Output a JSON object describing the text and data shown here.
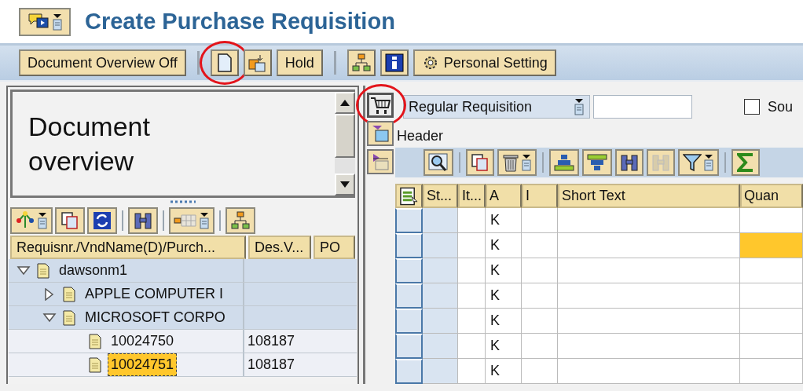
{
  "header": {
    "title": "Create Purchase Requisition"
  },
  "toolbar": [
    {
      "kind": "button",
      "label": "Document Overview Off",
      "highlighted": false
    },
    {
      "kind": "separator"
    },
    {
      "kind": "icon",
      "highlighted": true
    },
    {
      "kind": "icon",
      "highlighted": false
    },
    {
      "kind": "button",
      "label": "Hold",
      "highlighted": false
    },
    {
      "kind": "separator"
    },
    {
      "kind": "icon",
      "highlighted": false
    },
    {
      "kind": "icon",
      "highlighted": false
    },
    {
      "kind": "button",
      "label": "Personal Setting",
      "highlighted": false
    }
  ],
  "overview": {
    "title": "Document overview"
  },
  "tree": {
    "columns": [
      "Requisnr./VndName(D)/Purch...",
      "Des.V...",
      "PO"
    ],
    "items": [
      {
        "label": "dawsonm1",
        "expanded": true,
        "selected": false,
        "children": [
          {
            "label": "APPLE COMPUTER I",
            "expanded": false,
            "selected": false
          },
          {
            "label": "MICROSOFT CORPO",
            "expanded": true,
            "selected": false,
            "children": [
              {
                "label": "10024750",
                "des_v": "108187",
                "selected": false
              },
              {
                "label": "10024751",
                "des_v": "108187",
                "selected": true
              }
            ]
          }
        ]
      }
    ]
  },
  "document": {
    "cart_highlighted": true,
    "type": "Regular Requisition",
    "source_checkbox": {
      "label": "Sou",
      "checked": false
    },
    "section": "Header"
  },
  "grid": {
    "columns": [
      "St...",
      "It...",
      "A",
      "I",
      "Short Text",
      "Quan"
    ],
    "rows": [
      {
        "column_3": "K",
        "quantity_focused": false
      },
      {
        "column_3": "K",
        "quantity_focused": true
      },
      {
        "column_3": "K",
        "quantity_focused": false
      },
      {
        "column_3": "K",
        "quantity_focused": false
      },
      {
        "column_3": "K",
        "quantity_focused": false
      },
      {
        "column_3": "K",
        "quantity_focused": false
      },
      {
        "column_3": "K",
        "quantity_focused": false
      }
    ]
  }
}
